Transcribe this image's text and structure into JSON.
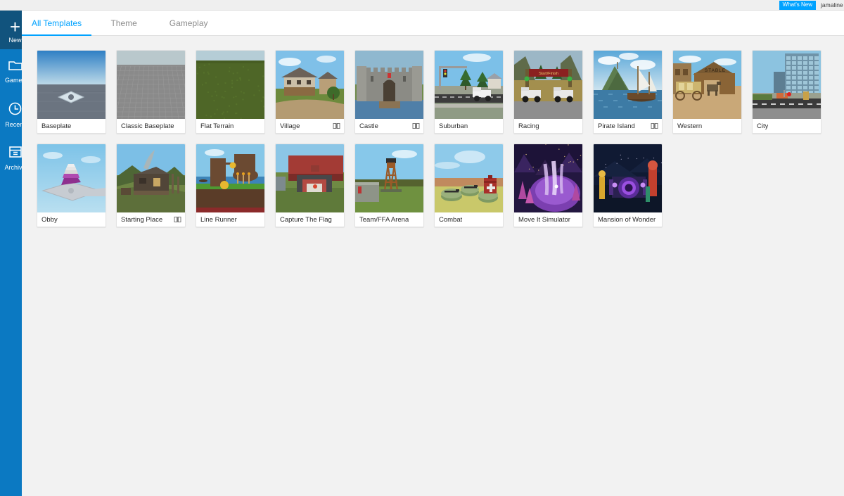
{
  "topbar": {
    "whats_new_label": "What's New",
    "user_name": "jamaline",
    "whats_new_color": "#00a2ff"
  },
  "sidebar": {
    "background_color": "#0b79c2",
    "active_background_color": "#11537d",
    "items": [
      {
        "label": "New",
        "icon": "plus-icon",
        "active": true
      },
      {
        "label": "Games",
        "icon": "folder-icon",
        "active": false
      },
      {
        "label": "Recent",
        "icon": "clock-icon",
        "active": false
      },
      {
        "label": "Archive",
        "icon": "archive-icon",
        "active": false
      }
    ]
  },
  "tabs": [
    {
      "label": "All Templates",
      "active": true
    },
    {
      "label": "Theme",
      "active": false
    },
    {
      "label": "Gameplay",
      "active": false
    }
  ],
  "accent_color": "#00a2ff",
  "content_background": "#f2f2f2",
  "templates": [
    {
      "title": "Baseplate",
      "has_tutorial": false,
      "art": "baseplate"
    },
    {
      "title": "Classic Baseplate",
      "has_tutorial": false,
      "art": "classic-baseplate"
    },
    {
      "title": "Flat Terrain",
      "has_tutorial": false,
      "art": "flat-terrain"
    },
    {
      "title": "Village",
      "has_tutorial": true,
      "art": "village"
    },
    {
      "title": "Castle",
      "has_tutorial": true,
      "art": "castle"
    },
    {
      "title": "Suburban",
      "has_tutorial": false,
      "art": "suburban"
    },
    {
      "title": "Racing",
      "has_tutorial": false,
      "art": "racing",
      "banner_text": "Start/Finish"
    },
    {
      "title": "Pirate Island",
      "has_tutorial": true,
      "art": "pirate-island"
    },
    {
      "title": "Western",
      "has_tutorial": false,
      "art": "western",
      "sign_text": "STABLE"
    },
    {
      "title": "City",
      "has_tutorial": false,
      "art": "city"
    },
    {
      "title": "Obby",
      "has_tutorial": false,
      "art": "obby"
    },
    {
      "title": "Starting Place",
      "has_tutorial": true,
      "art": "starting-place"
    },
    {
      "title": "Line Runner",
      "has_tutorial": false,
      "art": "line-runner"
    },
    {
      "title": "Capture The Flag",
      "has_tutorial": false,
      "art": "capture-the-flag"
    },
    {
      "title": "Team/FFA Arena",
      "has_tutorial": false,
      "art": "team-ffa-arena"
    },
    {
      "title": "Combat",
      "has_tutorial": false,
      "art": "combat"
    },
    {
      "title": "Move It Simulator",
      "has_tutorial": false,
      "art": "move-it-simulator"
    },
    {
      "title": "Mansion of Wonder",
      "has_tutorial": false,
      "art": "mansion-of-wonder"
    }
  ]
}
